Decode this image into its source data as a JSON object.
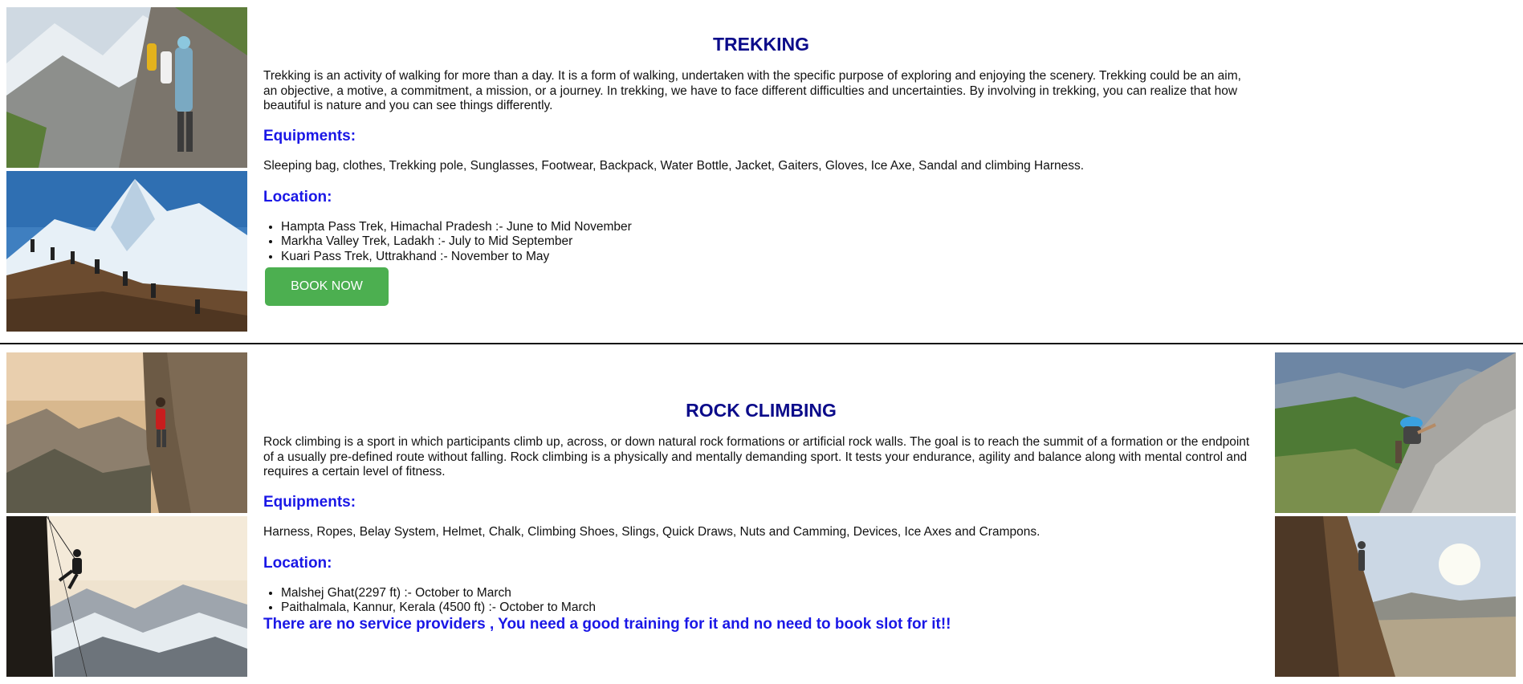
{
  "trekking": {
    "title": "TREKKING",
    "description": "Trekking is an activity of walking for more than a day. It is a form of walking, undertaken with the specific purpose of exploring and enjoying the scenery. Trekking could be an aim, an objective, a motive, a commitment, a mission, or a journey. In trekking, we have to face different difficulties and uncertainties. By involving in trekking, you can realize that how beautiful is nature and you can see things differently.",
    "equipments_heading": "Equipments:",
    "equipments": "Sleeping bag, clothes, Trekking pole, Sunglasses, Footwear, Backpack, Water Bottle, Jacket, Gaiters, Gloves, Ice Axe, Sandal and climbing Harness.",
    "location_heading": "Location:",
    "locations": [
      "Hampta Pass Trek, Himachal Pradesh :- June to Mid November",
      "Markha Valley Trek, Ladakh :- July to Mid September",
      "Kuari Pass Trek, Uttrakhand :- November to May"
    ],
    "button_label": "BOOK NOW"
  },
  "climbing": {
    "title": "ROCK CLIMBING",
    "description": "Rock climbing is a sport in which participants climb up, across, or down natural rock formations or artificial rock walls. The goal is to reach the summit of a formation or the endpoint of a usually pre-defined route without falling. Rock climbing is a physically and mentally demanding sport. It tests your endurance, agility and balance along with mental control and requires a certain level of fitness.",
    "equipments_heading": "Equipments:",
    "equipments": "Harness, Ropes, Belay System, Helmet, Chalk, Climbing Shoes, Slings, Quick Draws, Nuts and Camming, Devices, Ice Axes and Crampons.",
    "location_heading": "Location:",
    "locations": [
      "Malshej Ghat(2297 ft) :- October to March",
      "Paithalmala, Kannur, Kerala (4500 ft) :- October to March"
    ],
    "notice": "There are no service providers , You need a good training for it and no need to book slot for it!!"
  },
  "colors": {
    "title": "#0b0b8a",
    "subhead": "#1a17e6",
    "button": "#4caf50"
  }
}
